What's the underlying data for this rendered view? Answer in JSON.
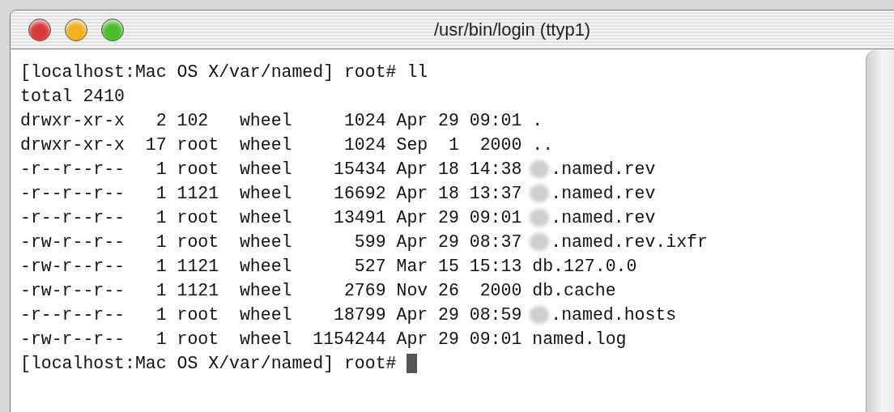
{
  "window": {
    "title": "/usr/bin/login (ttyp1)"
  },
  "lines": [
    {
      "kind": "prompt",
      "text": "[localhost:Mac OS X/var/named] root# ll",
      "cursor": false
    },
    {
      "kind": "output",
      "text": "total 2410"
    },
    {
      "kind": "entry",
      "listing": "drwxr-xr-x   2 102   wheel     1024 Apr 29 09:01",
      "filename": ".",
      "redacted": false
    },
    {
      "kind": "entry",
      "listing": "drwxr-xr-x  17 root  wheel     1024 Sep  1  2000",
      "filename": "..",
      "redacted": false
    },
    {
      "kind": "entry",
      "listing": "-r--r--r--   1 root  wheel    15434 Apr 18 14:38",
      "filename": ".named.rev",
      "redacted": true
    },
    {
      "kind": "entry",
      "listing": "-r--r--r--   1 1121  wheel    16692 Apr 18 13:37",
      "filename": ".named.rev",
      "redacted": true
    },
    {
      "kind": "entry",
      "listing": "-r--r--r--   1 root  wheel    13491 Apr 29 09:01",
      "filename": ".named.rev",
      "redacted": true
    },
    {
      "kind": "entry",
      "listing": "-rw-r--r--   1 root  wheel      599 Apr 29 08:37",
      "filename": ".named.rev.ixfr",
      "redacted": true
    },
    {
      "kind": "entry",
      "listing": "-rw-r--r--   1 1121  wheel      527 Mar 15 15:13",
      "filename": "db.127.0.0",
      "redacted": false
    },
    {
      "kind": "entry",
      "listing": "-rw-r--r--   1 1121  wheel     2769 Nov 26  2000",
      "filename": "db.cache",
      "redacted": false
    },
    {
      "kind": "entry",
      "listing": "-r--r--r--   1 root  wheel    18799 Apr 29 08:59",
      "filename": ".named.hosts",
      "redacted": true
    },
    {
      "kind": "entry",
      "listing": "-rw-r--r--   1 root  wheel  1154244 Apr 29 09:01",
      "filename": "named.log",
      "redacted": false
    },
    {
      "kind": "prompt",
      "text": "[localhost:Mac OS X/var/named] root#",
      "cursor": true
    }
  ]
}
